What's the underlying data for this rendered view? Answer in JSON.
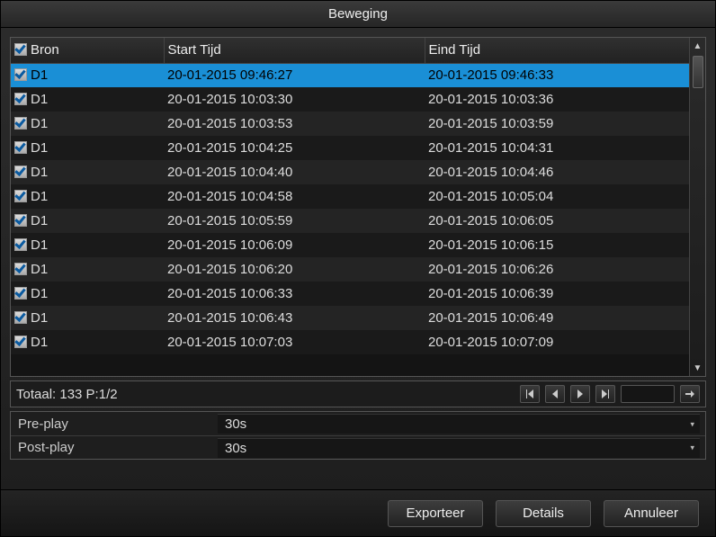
{
  "title": "Beweging",
  "columns": {
    "bron": "Bron",
    "start": "Start Tijd",
    "eind": "Eind Tijd"
  },
  "rows": [
    {
      "bron": "D1",
      "start": "20-01-2015 09:46:27",
      "eind": "20-01-2015 09:46:33",
      "selected": true
    },
    {
      "bron": "D1",
      "start": "20-01-2015 10:03:30",
      "eind": "20-01-2015 10:03:36"
    },
    {
      "bron": "D1",
      "start": "20-01-2015 10:03:53",
      "eind": "20-01-2015 10:03:59"
    },
    {
      "bron": "D1",
      "start": "20-01-2015 10:04:25",
      "eind": "20-01-2015 10:04:31"
    },
    {
      "bron": "D1",
      "start": "20-01-2015 10:04:40",
      "eind": "20-01-2015 10:04:46"
    },
    {
      "bron": "D1",
      "start": "20-01-2015 10:04:58",
      "eind": "20-01-2015 10:05:04"
    },
    {
      "bron": "D1",
      "start": "20-01-2015 10:05:59",
      "eind": "20-01-2015 10:06:05"
    },
    {
      "bron": "D1",
      "start": "20-01-2015 10:06:09",
      "eind": "20-01-2015 10:06:15"
    },
    {
      "bron": "D1",
      "start": "20-01-2015 10:06:20",
      "eind": "20-01-2015 10:06:26"
    },
    {
      "bron": "D1",
      "start": "20-01-2015 10:06:33",
      "eind": "20-01-2015 10:06:39"
    },
    {
      "bron": "D1",
      "start": "20-01-2015 10:06:43",
      "eind": "20-01-2015 10:06:49"
    },
    {
      "bron": "D1",
      "start": "20-01-2015 10:07:03",
      "eind": "20-01-2015 10:07:09"
    }
  ],
  "status": "Totaal:  133  P:1/2",
  "preplay": {
    "label": "Pre-play",
    "value": "30s"
  },
  "postplay": {
    "label": "Post-play",
    "value": "30s"
  },
  "buttons": {
    "export": "Exporteer",
    "details": "Details",
    "cancel": "Annuleer"
  }
}
